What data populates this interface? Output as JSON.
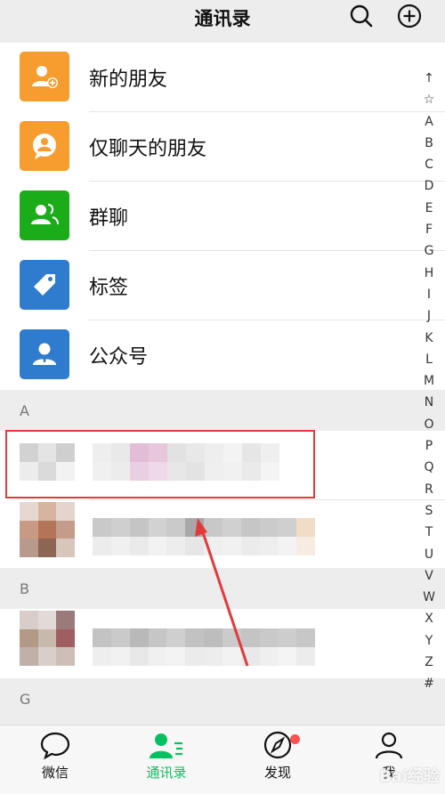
{
  "header": {
    "title": "通讯录",
    "search_icon": "search-icon",
    "add_icon": "add-icon"
  },
  "functions": [
    {
      "label": "新的朋友",
      "icon": "new-friend-icon",
      "color": "#f79c2e"
    },
    {
      "label": "仅聊天的朋友",
      "icon": "chat-only-icon",
      "color": "#f79c2e"
    },
    {
      "label": "群聊",
      "icon": "group-chat-icon",
      "color": "#1aad19"
    },
    {
      "label": "标签",
      "icon": "tag-icon",
      "color": "#2f7ccf"
    },
    {
      "label": "公众号",
      "icon": "official-account-icon",
      "color": "#2f7ccf"
    }
  ],
  "sections": [
    "A",
    "B",
    "G"
  ],
  "index_letters": [
    "↑",
    "☆",
    "A",
    "B",
    "C",
    "D",
    "E",
    "F",
    "G",
    "H",
    "I",
    "J",
    "K",
    "L",
    "M",
    "N",
    "O",
    "P",
    "Q",
    "R",
    "S",
    "T",
    "U",
    "V",
    "W",
    "X",
    "Y",
    "Z",
    "#"
  ],
  "tabbar": {
    "tabs": [
      {
        "label": "微信",
        "icon": "chat-bubble-icon"
      },
      {
        "label": "通讯录",
        "icon": "contacts-icon",
        "active": true
      },
      {
        "label": "发现",
        "icon": "compass-icon",
        "badge": true
      },
      {
        "label": "我",
        "icon": "profile-icon"
      }
    ]
  },
  "watermark": "Bai经验",
  "colors": {
    "accent": "#07c160",
    "annotation": "#e23a3a"
  }
}
